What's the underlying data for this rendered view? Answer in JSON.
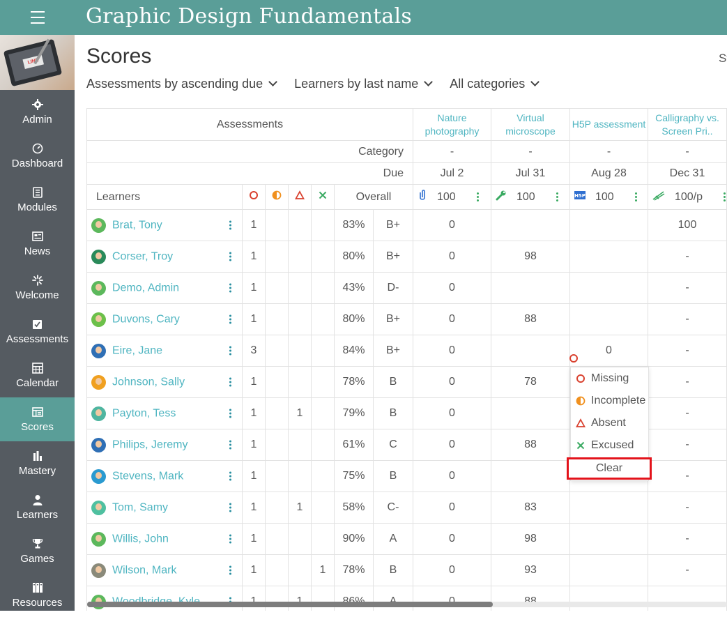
{
  "app": {
    "course_title": "Graphic Design Fundamentals"
  },
  "sidebar": {
    "items": [
      {
        "label": "Admin",
        "icon": "gear-icon"
      },
      {
        "label": "Dashboard",
        "icon": "dashboard-icon"
      },
      {
        "label": "Modules",
        "icon": "modules-icon"
      },
      {
        "label": "News",
        "icon": "news-icon"
      },
      {
        "label": "Welcome",
        "icon": "welcome-icon"
      },
      {
        "label": "Assessments",
        "icon": "assessments-icon"
      },
      {
        "label": "Calendar",
        "icon": "calendar-icon"
      },
      {
        "label": "Scores",
        "icon": "scores-icon",
        "active": true
      },
      {
        "label": "Mastery",
        "icon": "mastery-icon"
      },
      {
        "label": "Learners",
        "icon": "learners-icon"
      },
      {
        "label": "Games",
        "icon": "trophy-icon"
      },
      {
        "label": "Resources",
        "icon": "resources-icon"
      }
    ]
  },
  "page": {
    "title": "Scores",
    "right_text": "St"
  },
  "filters": {
    "sort_assessments": "Assessments by ascending due",
    "sort_learners": "Learners by last name",
    "categories": "All categories"
  },
  "table": {
    "assessments_header": "Assessments",
    "category_label": "Category",
    "due_label": "Due",
    "learners_label": "Learners",
    "overall_label": "Overall",
    "assessments": [
      {
        "name": "Nature photography",
        "category": "-",
        "due": "Jul 2",
        "points": "100",
        "icon": "attachment-icon"
      },
      {
        "name": "Virtual microscope",
        "category": "-",
        "due": "Jul 31",
        "points": "100",
        "icon": "wrench-icon"
      },
      {
        "name": "H5P assessment",
        "category": "-",
        "due": "Aug 28",
        "points": "100",
        "icon": "h5p-icon"
      },
      {
        "name": "Calligraphy vs. Screen Pri..",
        "category": "-",
        "due": "Dec 31",
        "points": "100/p",
        "icon": "calligraphy-icon"
      }
    ],
    "learners": [
      {
        "name": "Brat, Tony",
        "missing": "1",
        "incomplete": "",
        "absent": "",
        "excused": "",
        "pct": "83%",
        "grade": "B+",
        "scores": [
          "0",
          "",
          "",
          "100"
        ],
        "avatar": "#5cb85c"
      },
      {
        "name": "Corser, Troy",
        "missing": "1",
        "incomplete": "",
        "absent": "",
        "excused": "",
        "pct": "80%",
        "grade": "B+",
        "scores": [
          "0",
          "98",
          "",
          "-"
        ],
        "avatar": "#2a8a5a"
      },
      {
        "name": "Demo, Admin",
        "missing": "1",
        "incomplete": "",
        "absent": "",
        "excused": "",
        "pct": "43%",
        "grade": "D-",
        "scores": [
          "0",
          "",
          "",
          "-"
        ],
        "avatar": "#5cb85c"
      },
      {
        "name": "Duvons, Cary",
        "missing": "1",
        "incomplete": "",
        "absent": "",
        "excused": "",
        "pct": "80%",
        "grade": "B+",
        "scores": [
          "0",
          "88",
          "",
          "-"
        ],
        "avatar": "#6cc04a"
      },
      {
        "name": "Eire, Jane",
        "missing": "3",
        "incomplete": "",
        "absent": "",
        "excused": "",
        "pct": "84%",
        "grade": "B+",
        "scores": [
          "0",
          "",
          "0",
          "-"
        ],
        "avatar": "#2f6fb5"
      },
      {
        "name": "Johnson, Sally",
        "missing": "1",
        "incomplete": "",
        "absent": "",
        "excused": "",
        "pct": "78%",
        "grade": "B",
        "scores": [
          "0",
          "78",
          "",
          "-"
        ],
        "avatar": "#f0a020"
      },
      {
        "name": "Payton, Tess",
        "missing": "1",
        "incomplete": "",
        "absent": "1",
        "excused": "",
        "pct": "79%",
        "grade": "B",
        "scores": [
          "0",
          "",
          "",
          "-"
        ],
        "avatar": "#4fb5a0"
      },
      {
        "name": "Philips, Jeremy",
        "missing": "1",
        "incomplete": "",
        "absent": "",
        "excused": "",
        "pct": "61%",
        "grade": "C",
        "scores": [
          "0",
          "88",
          "",
          "-"
        ],
        "avatar": "#2f6fb5"
      },
      {
        "name": "Stevens, Mark",
        "missing": "1",
        "incomplete": "",
        "absent": "",
        "excused": "",
        "pct": "75%",
        "grade": "B",
        "scores": [
          "0",
          "",
          "",
          "-"
        ],
        "avatar": "#2a9ad0"
      },
      {
        "name": "Tom, Samy",
        "missing": "1",
        "incomplete": "",
        "absent": "1",
        "excused": "",
        "pct": "58%",
        "grade": "C-",
        "scores": [
          "0",
          "83",
          "",
          "-"
        ],
        "avatar": "#4fc0a0"
      },
      {
        "name": "Willis, John",
        "missing": "1",
        "incomplete": "",
        "absent": "",
        "excused": "",
        "pct": "90%",
        "grade": "A",
        "scores": [
          "0",
          "98",
          "",
          "-"
        ],
        "avatar": "#5cb85c"
      },
      {
        "name": "Wilson, Mark",
        "missing": "1",
        "incomplete": "",
        "absent": "",
        "excused": "1",
        "pct": "78%",
        "grade": "B",
        "scores": [
          "0",
          "93",
          "",
          "-"
        ],
        "avatar": "#8a8a7a"
      },
      {
        "name": "Woodbridge, Kyle",
        "missing": "1",
        "incomplete": "",
        "absent": "1",
        "excused": "",
        "pct": "86%",
        "grade": "A",
        "scores": [
          "0",
          "88",
          "",
          ""
        ],
        "avatar": "#5cb85c"
      }
    ]
  },
  "popup": {
    "options": [
      {
        "label": "Missing",
        "icon": "circle-icon",
        "color": "#d9412f"
      },
      {
        "label": "Incomplete",
        "icon": "half-circle-icon",
        "color": "#f0901e"
      },
      {
        "label": "Absent",
        "icon": "triangle-icon",
        "color": "#d9412f"
      },
      {
        "label": "Excused",
        "icon": "x-icon",
        "color": "#3aaa62"
      }
    ],
    "clear_label": "Clear"
  },
  "colors": {
    "brand": "#5a9e98",
    "sidebar": "#555b61",
    "link": "#4fb5c1",
    "missing": "#d9412f",
    "incomplete": "#f0901e",
    "excused": "#3aaa62",
    "highlight": "#e3131b"
  }
}
